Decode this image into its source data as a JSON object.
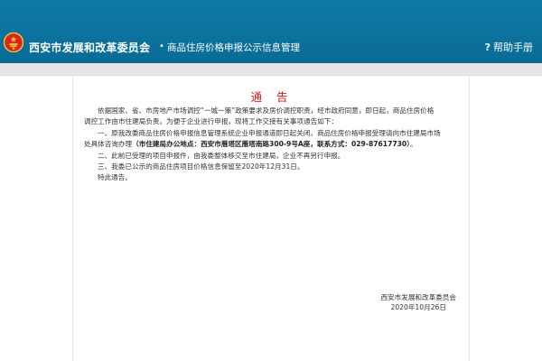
{
  "header": {
    "site_title": "西安市发展和改革委员会",
    "separator": "•",
    "subtitle": "商品住房价格申报公示信息管理",
    "help_icon": "question-icon",
    "help_label": "帮助手册",
    "emblem": "national-emblem-icon"
  },
  "notice": {
    "title": "通 告",
    "paragraphs": {
      "p1_line1": "依据国家、省、市房地产市场调控“一城一策”政策要求及房价调控职责，经市政府同意，即日起，商品住房价格",
      "p1_line2": "调控工作由市住建局负责。为便于企业进行申报，现将工作交接有关事项通告如下：",
      "p2_line1": "一、原我改委商品住房价格申报信息管理系统企业申报通道即日起关闭，商品住房价格申报受理请向市住建局市场",
      "p2_line2_prefix": "处具体咨询办理",
      "p2_line2_bold": "（市住建局办公地点：西安市雁塔区雁塔南路300-9号A座，联系方式：029-87617730）",
      "p2_line2_suffix": "。",
      "p3": "二、此前已受理的项目申报件，由我委整体移交至市住建局，企业不再另行申报。",
      "p4": "三、我委已公示的商品住房项目价格信息保留至2020年12月31日。",
      "p5": "特此通告。"
    },
    "signature": {
      "org": "西安市发展和改革委员会",
      "date": "2020年10月26日"
    }
  },
  "colors": {
    "header_bg": "#0c729f",
    "notice_title": "#cc1f1f",
    "strip_bg": "#e6e6e6"
  }
}
